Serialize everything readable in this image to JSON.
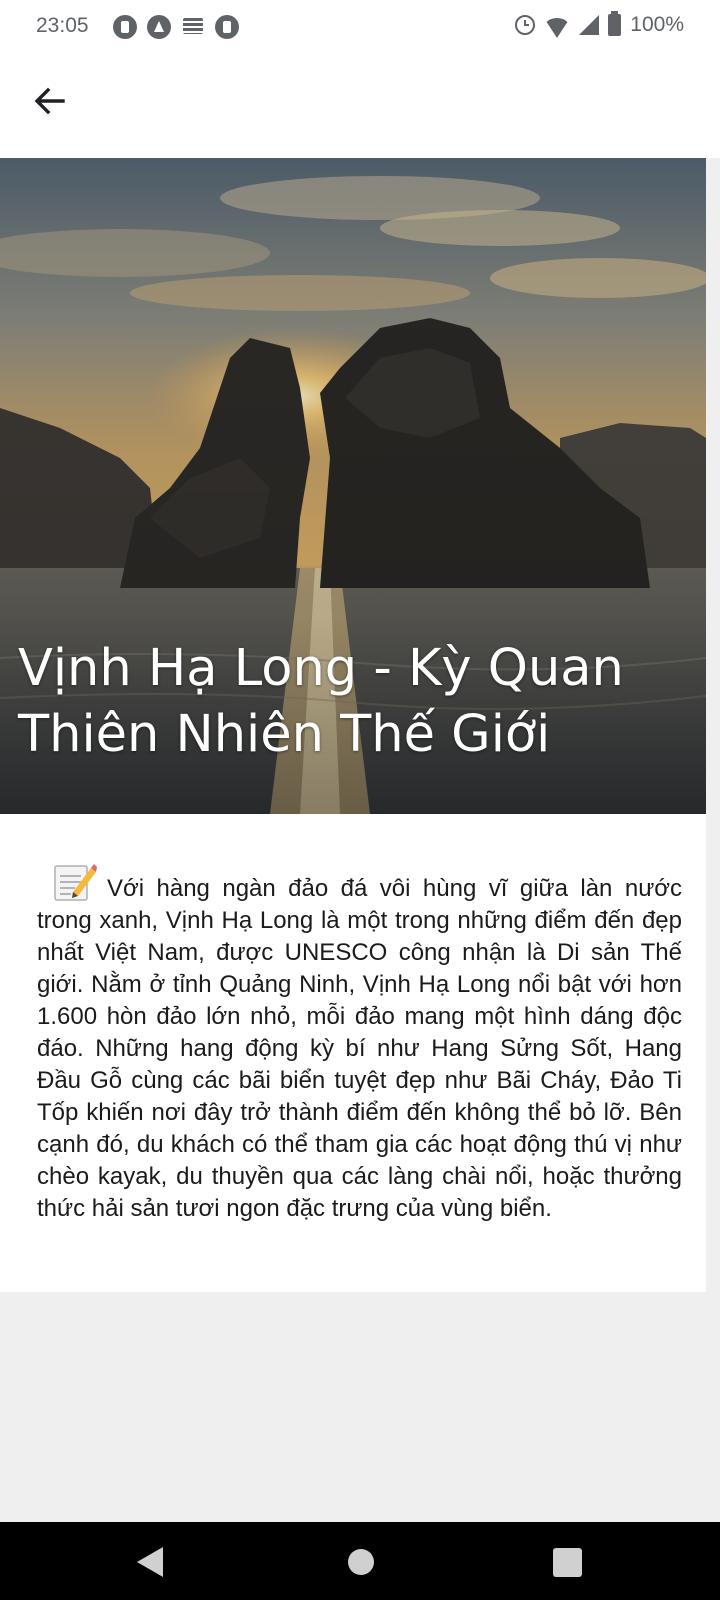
{
  "status_bar": {
    "time": "23:05",
    "battery": "100%",
    "notification_icons": [
      "app-p-icon",
      "app-a-icon",
      "storage-icon",
      "app-p-icon"
    ],
    "system_icons": [
      "alarm-icon",
      "wifi-icon",
      "signal-icon",
      "battery-icon"
    ]
  },
  "app_bar": {
    "back_icon": "arrow-left-icon"
  },
  "hero": {
    "title": "Vịnh Hạ Long - Kỳ Quan Thiên Nhiên Thế Giới",
    "image_description_icon": "landscape-photo"
  },
  "article": {
    "lead_icon": "memo-icon",
    "body": "Với hàng ngàn đảo đá vôi hùng vĩ giữa làn nước trong xanh, Vịnh Hạ Long là một trong những điểm đến đẹp nhất Việt Nam, được UNESCO công nhận là Di sản Thế giới. Nằm ở tỉnh Quảng Ninh, Vịnh Hạ Long nổi bật với hơn 1.600 hòn đảo lớn nhỏ, mỗi đảo mang một hình dáng độc đáo. Những hang động kỳ bí như Hang Sửng Sốt, Hang Đầu Gỗ cùng các bãi biển tuyệt đẹp như Bãi Cháy, Đảo Ti Tốp khiến nơi đây trở thành điểm đến không thể bỏ lỡ. Bên cạnh đó, du khách có thể tham gia các hoạt động thú vị như chèo kayak, du thuyền qua các làng chài nổi, hoặc thưởng thức hải sản tươi ngon đặc trưng của vùng biển."
  },
  "nav_bar": {
    "icons": [
      "nav-back-icon",
      "nav-home-icon",
      "nav-recents-icon"
    ]
  },
  "colors": {
    "status_text": "#5f6368",
    "content_background": "#ffffff",
    "page_background": "#efefef",
    "title_text": "#ffffff",
    "body_text": "#1b1b1b",
    "nav_bar": "#000000"
  }
}
